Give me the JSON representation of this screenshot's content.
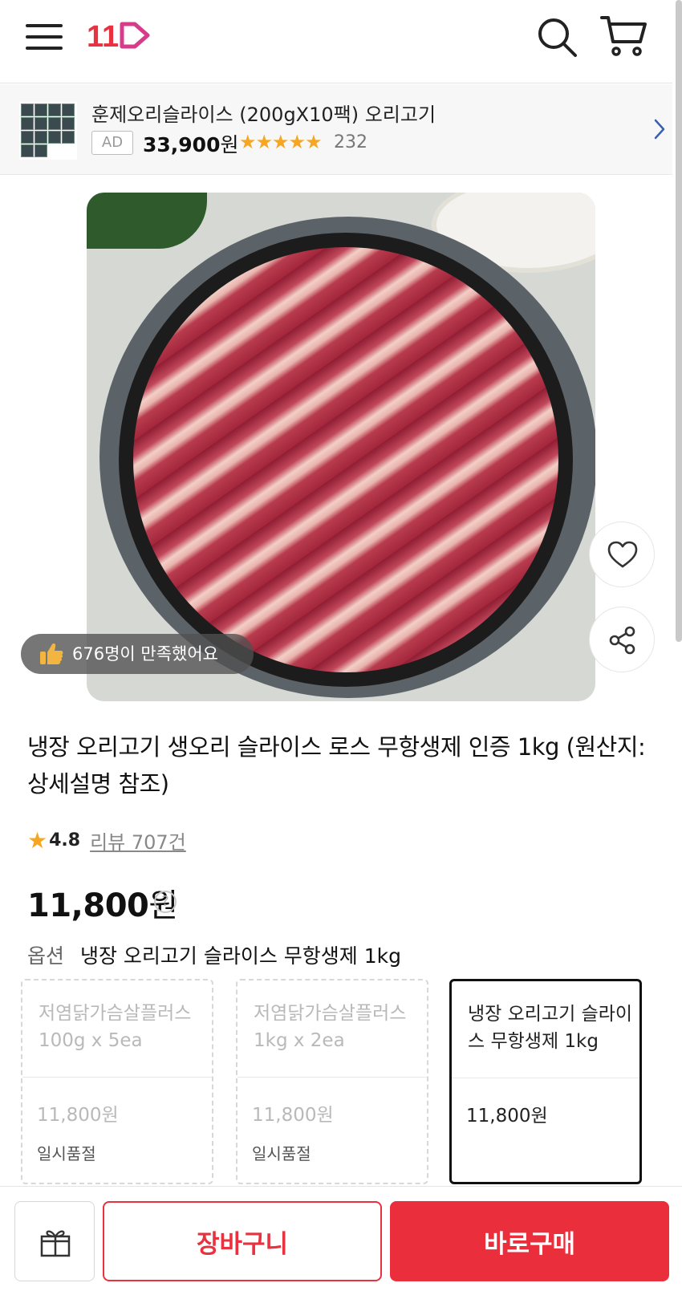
{
  "header": {
    "logo_text": "11",
    "icons": [
      "menu-icon",
      "search-icon",
      "cart-icon"
    ],
    "logo_color": "#e8323f"
  },
  "ad": {
    "title": "훈제오리슬라이스 (200gX10팩) 오리고기",
    "tag": "AD",
    "price": "33,900",
    "price_unit": "원",
    "stars": "★★★★★",
    "rating_count": "232"
  },
  "product": {
    "satisfied_text": "676명이 만족했어요",
    "title": "냉장 오리고기 생오리 슬라이스 로스 무항생제 인증 1kg (원산지: 상세설명 참조)",
    "rating_star": "★",
    "rating": "4.8",
    "review_link": "리뷰 707건",
    "price": "11,800",
    "price_unit": "원",
    "price_help": "?",
    "option_label": "옵션",
    "option_value": "냉장 오리고기 슬라이스 무항생제 1kg"
  },
  "options": [
    {
      "name": "저염닭가슴살플러스 100g x 5ea",
      "price": "11,800원",
      "status": "일시품절",
      "selected": false
    },
    {
      "name": "저염닭가슴살플러스 1kg x 2ea",
      "price": "11,800원",
      "status": "일시품절",
      "selected": false
    },
    {
      "name": "냉장 오리고기 슬라이스 무항생제 1kg",
      "price": "11,800원",
      "status": "",
      "selected": true
    }
  ],
  "bottom_bar": {
    "cart_label": "장바구니",
    "buy_label": "바로구매"
  },
  "colors": {
    "accent": "#e8323f",
    "star": "#f5a623"
  }
}
